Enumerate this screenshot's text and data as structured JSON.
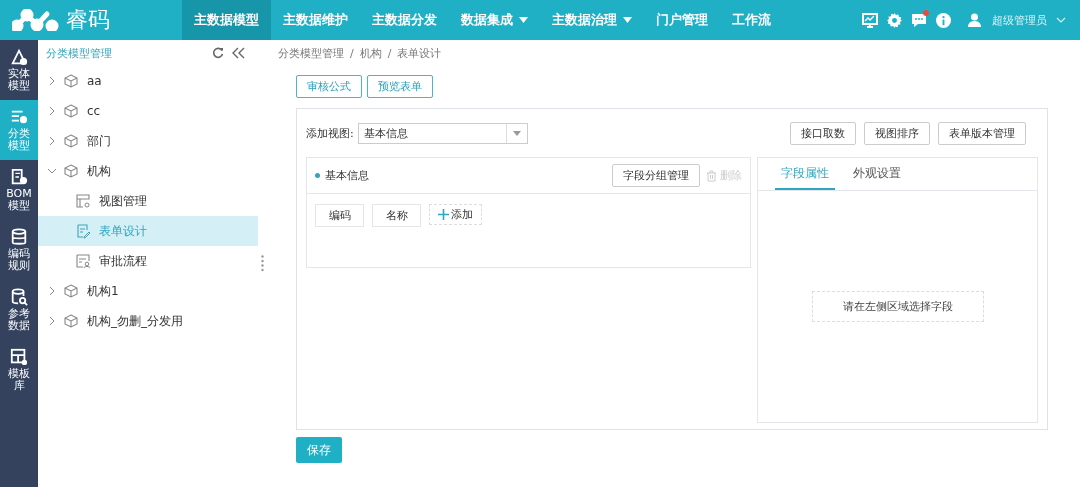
{
  "header": {
    "logo": "睿码",
    "nav": [
      {
        "label": "主数据模型",
        "selected": true,
        "dropdown": false
      },
      {
        "label": "主数据维护",
        "selected": false,
        "dropdown": false
      },
      {
        "label": "主数据分发",
        "selected": false,
        "dropdown": false
      },
      {
        "label": "数据集成",
        "selected": false,
        "dropdown": true
      },
      {
        "label": "主数据治理",
        "selected": false,
        "dropdown": true
      },
      {
        "label": "门户管理",
        "selected": false,
        "dropdown": false
      },
      {
        "label": "工作流",
        "selected": false,
        "dropdown": false
      }
    ],
    "messages_unread": true,
    "user": "超级管理员"
  },
  "rail": [
    {
      "kind": "entity",
      "lines": [
        "实体",
        "模型"
      ],
      "selected": false
    },
    {
      "kind": "classify",
      "lines": [
        "分类",
        "模型"
      ],
      "selected": true
    },
    {
      "kind": "bom",
      "lines": [
        "BOM",
        "模型"
      ],
      "selected": false
    },
    {
      "kind": "code",
      "lines": [
        "编码",
        "规则"
      ],
      "selected": false
    },
    {
      "kind": "reference",
      "lines": [
        "参考",
        "数据"
      ],
      "selected": false
    },
    {
      "kind": "template",
      "lines": [
        "模板",
        "库"
      ],
      "selected": false
    }
  ],
  "tree": {
    "title": "分类模型管理",
    "items": [
      {
        "kind": "model",
        "label": "aa",
        "expanded": false,
        "selected": false
      },
      {
        "kind": "model",
        "label": "cc",
        "expanded": false,
        "selected": false
      },
      {
        "kind": "model",
        "label": "部门",
        "expanded": false,
        "selected": false
      },
      {
        "kind": "model",
        "label": "机构",
        "expanded": true,
        "selected": false,
        "children": [
          {
            "kind": "view",
            "label": "视图管理",
            "selected": false
          },
          {
            "kind": "form",
            "label": "表单设计",
            "selected": true
          },
          {
            "kind": "flow",
            "label": "审批流程",
            "selected": false
          }
        ]
      },
      {
        "kind": "model",
        "label": "机构1",
        "expanded": false,
        "selected": false
      },
      {
        "kind": "model",
        "label": "机构_勿删_分发用",
        "expanded": false,
        "selected": false
      }
    ]
  },
  "breadcrumb": {
    "items": [
      "分类模型管理",
      "机构",
      "表单设计"
    ],
    "separators": [
      "/",
      "/"
    ]
  },
  "toolbar": [
    "审核公式",
    "预览表单"
  ],
  "view_select": {
    "label": "添加视图:",
    "value": "基本信息"
  },
  "actions": [
    "接口取数",
    "视图排序",
    "表单版本管理"
  ],
  "group": {
    "title": "基本信息",
    "manage_button": "字段分组管理",
    "delete": {
      "label": "删除",
      "disabled": true
    },
    "fields": [
      "编码",
      "名称"
    ],
    "add": "添加"
  },
  "properties": {
    "tabs": [
      {
        "label": "字段属性",
        "selected": true
      },
      {
        "label": "外观设置",
        "selected": false
      }
    ],
    "hint": "请在左侧区域选择字段"
  },
  "save": "保存"
}
